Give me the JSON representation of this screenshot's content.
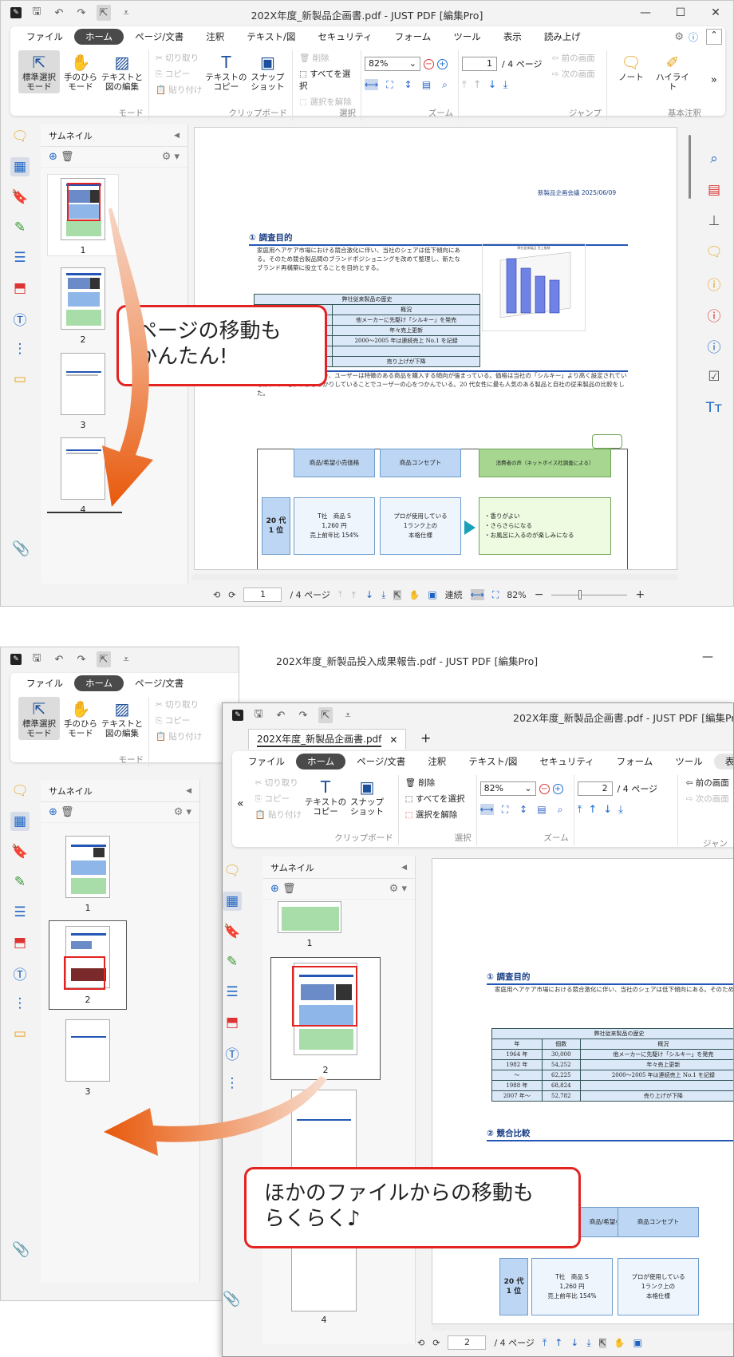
{
  "window1": {
    "title": "202X年度_新製品企画書.pdf - JUST PDF [編集Pro]",
    "tabs": [
      "ファイル",
      "ホーム",
      "ページ/文書",
      "注釈",
      "テキスト/図",
      "セキュリティ",
      "フォーム",
      "ツール",
      "表示",
      "読み上げ"
    ],
    "ribbon": {
      "mode": {
        "select": "標準選択\nモード",
        "hand": "手のひら\nモード",
        "textedit": "テキストと\n図の編集",
        "group": "モード"
      },
      "clipboard": {
        "cut": "切り取り",
        "copy": "コピー",
        "paste": "貼り付け",
        "textcopy": "テキストの\nコピー",
        "snapshot": "スナップ\nショット",
        "group": "クリップボード"
      },
      "select": {
        "delete": "削除",
        "selectall": "すべてを選択",
        "deselect": "選択を解除",
        "group": "選択"
      },
      "zoom": {
        "value": "82%",
        "group": "ズーム"
      },
      "jump": {
        "page": "1",
        "total": "/ 4 ページ",
        "prev": "前の画面",
        "next": "次の画面",
        "group": "ジャンプ"
      },
      "note": {
        "note": "ノート",
        "highlight": "ハイライト",
        "group": "基本注釈"
      }
    },
    "panel": {
      "title": "サムネイル",
      "thumbs": [
        "1",
        "2",
        "3",
        "4"
      ]
    },
    "status": {
      "page": "1",
      "total": "/ 4 ページ",
      "mode": "連続",
      "zoom": "82%"
    }
  },
  "doc1": {
    "date": "新製品企画会議 2025/06/09",
    "sec1": "① 調査目的",
    "sec1_text": "家庭用ヘアケア市場における競合激化に伴い、当社のシェアは低下傾向にある。そのため競合製品間のブランドポジショニングを改めて整理し、新たなブランド再構築に役立てることを目的とする。",
    "table_title": "弊社従来製品の歴史",
    "table_head": [
      "年",
      "個数",
      "概況"
    ],
    "rows": [
      [
        "1964 年",
        "30,000",
        "他メーカーに先駆け「シルキー」を発売"
      ],
      [
        "1982 年",
        "54,252",
        "年々売上更新"
      ],
      [
        "〜",
        "62,225",
        "2000〜2005 年は連続売上 No.1 を記録"
      ],
      [
        "1988 年",
        "68,824",
        ""
      ],
      [
        "2007 年〜",
        "52,782",
        "売り上げが下降"
      ]
    ],
    "sec2": "② 競合比較",
    "sec2_text": "ここ数年の傾向を見る限り、ユーザーは特徴のある商品を購入する傾向が強まっている。価格は当社の「シルキー」より高く設定されているが、コンセプトがしっかりしていることでユーザーの心をつかんでいる。20 代女性に最も人気のある製品と自社の従来製品の比較をした。",
    "cmp_head": [
      "商品/希望小売価格",
      "商品コンセプト",
      "消費者の声（ネットボイス社調査による）"
    ],
    "rank": "20 代\n1 位",
    "product": "T社　商品 S\n1,260 円\n売上前年比 154%",
    "concept": "プロが使用している\n1ランク上の\n本格仕様",
    "voice": "・香りがよい\n・さらさらになる\n・お風呂に入るのが楽しみになる",
    "chart_title": "弊社従来製品 売上推移"
  },
  "window2": {
    "title": "202X年度_新製品投入成果報告.pdf - JUST PDF [編集Pro]",
    "tabs": [
      "ファイル",
      "ホーム",
      "ページ/文書",
      "注釈",
      "テキスト/図",
      "セキュリティ",
      "フォーム",
      "ツール",
      "表示",
      "読み上げ"
    ],
    "panel": {
      "title": "サムネイル",
      "thumbs": [
        "1",
        "2",
        "3"
      ]
    }
  },
  "window3": {
    "title": "202X年度_新製品企画書.pdf - JUST PDF [編集Pro",
    "filetab": "202X年度_新製品企画書.pdf",
    "tabs": [
      "ファイル",
      "ホーム",
      "ページ/文書",
      "注釈",
      "テキスト/図",
      "セキュリティ",
      "フォーム",
      "ツール",
      "表示"
    ],
    "ribbon": {
      "delete": "削除",
      "selectall": "すべてを選択",
      "deselect": "選択を解除",
      "zoom": "82%",
      "page": "2",
      "total": "/ 4 ページ",
      "prev": "前の画面",
      "next": "次の画面",
      "cut": "切り取り",
      "copy": "コピー",
      "paste": "貼り付け",
      "textcopy": "テキストの\nコピー",
      "snapshot": "スナップ\nショット",
      "group_clip": "クリップボード",
      "group_sel": "選択",
      "group_zoom": "ズーム",
      "group_jump": "ジャン"
    },
    "panel": {
      "title": "サムネイル",
      "thumbs": [
        "1",
        "2",
        "4"
      ]
    },
    "status": {
      "page": "2",
      "total": "/ 4 ページ"
    }
  },
  "callout1": "ページの移動も\nかんたん!",
  "callout2": "ほかのファイルからの移動も\nらくらく♪",
  "colors": {
    "accent": "#e32222",
    "arrow": "#e8590c",
    "blue": "#2167c5"
  }
}
